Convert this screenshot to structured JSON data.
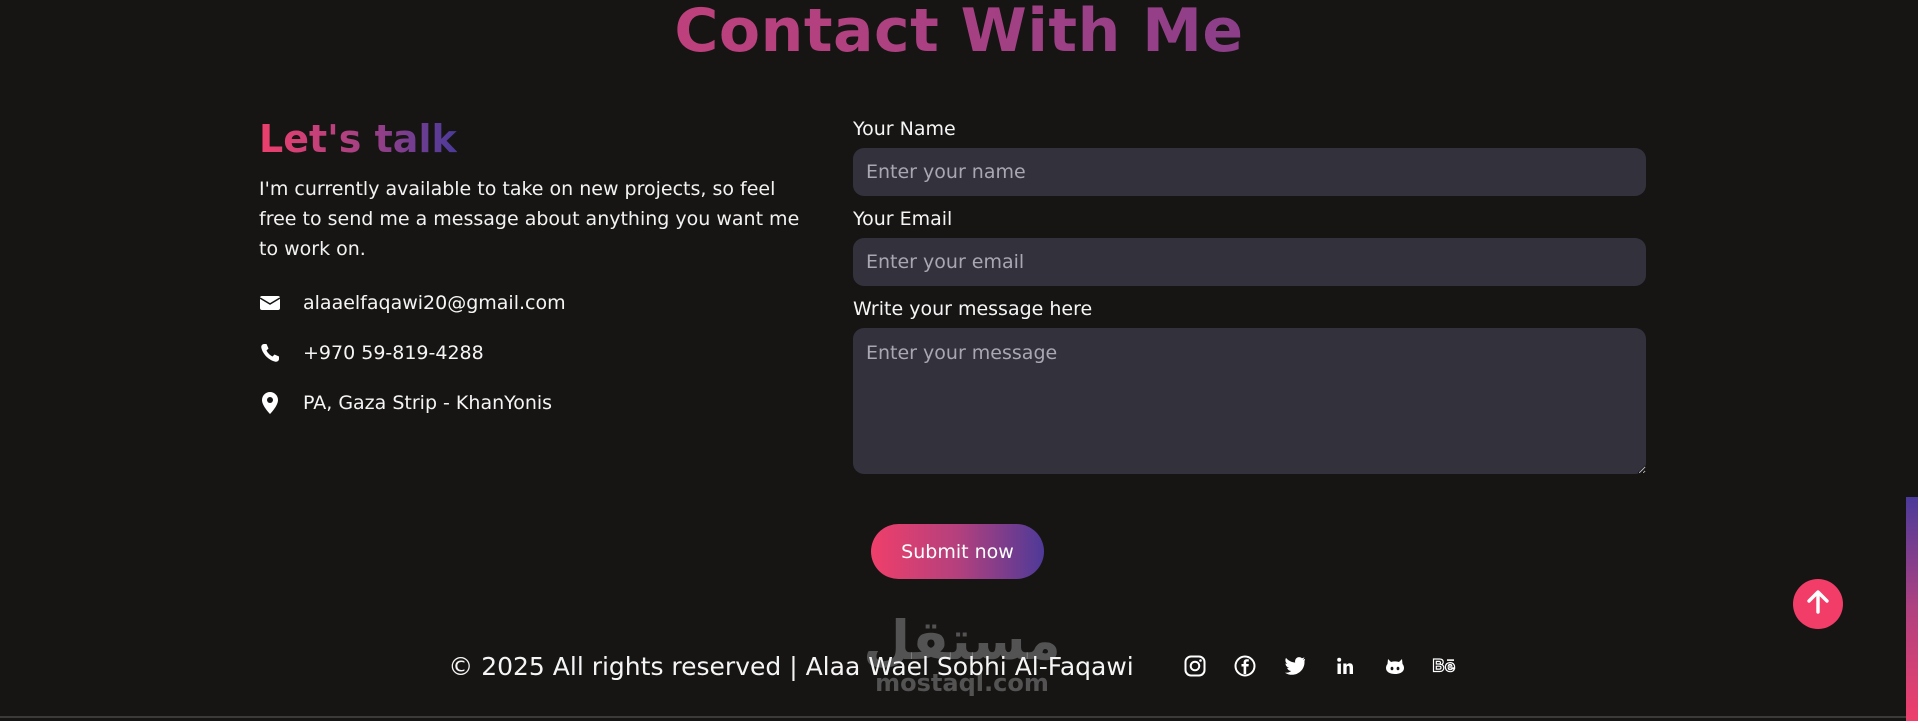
{
  "section": {
    "title": "Contact With Me"
  },
  "left": {
    "heading": "Let's talk",
    "intro": "I'm currently available to take on new projects, so feel free to send me a message about anything you want me to work on.",
    "contacts": [
      {
        "icon": "envelope-icon",
        "text": "alaaelfaqawi20@gmail.com"
      },
      {
        "icon": "phone-icon",
        "text": "+970 59-819-4288"
      },
      {
        "icon": "location-pin-icon",
        "text": "PA, Gaza Strip - KhanYonis"
      }
    ]
  },
  "form": {
    "name_label": "Your Name",
    "name_placeholder": "Enter your name",
    "email_label": "Your Email",
    "email_placeholder": "Enter your email",
    "message_label": "Write your message here",
    "message_placeholder": "Enter your message",
    "submit_label": "Submit now"
  },
  "footer": {
    "copyright": "© 2025 All rights reserved | Alaa Wael Sobhi Al-Faqawi",
    "socials": [
      "instagram-icon",
      "facebook-icon",
      "twitter-icon",
      "linkedin-icon",
      "github-icon",
      "behance-icon"
    ]
  },
  "watermark": {
    "arabic": "مستقل",
    "latin": "mostaql.com"
  },
  "colors": {
    "background": "#161514",
    "accent_pink": "#ee3f6c",
    "accent_purple": "#4b3a9a",
    "field_bg": "#33323c"
  }
}
